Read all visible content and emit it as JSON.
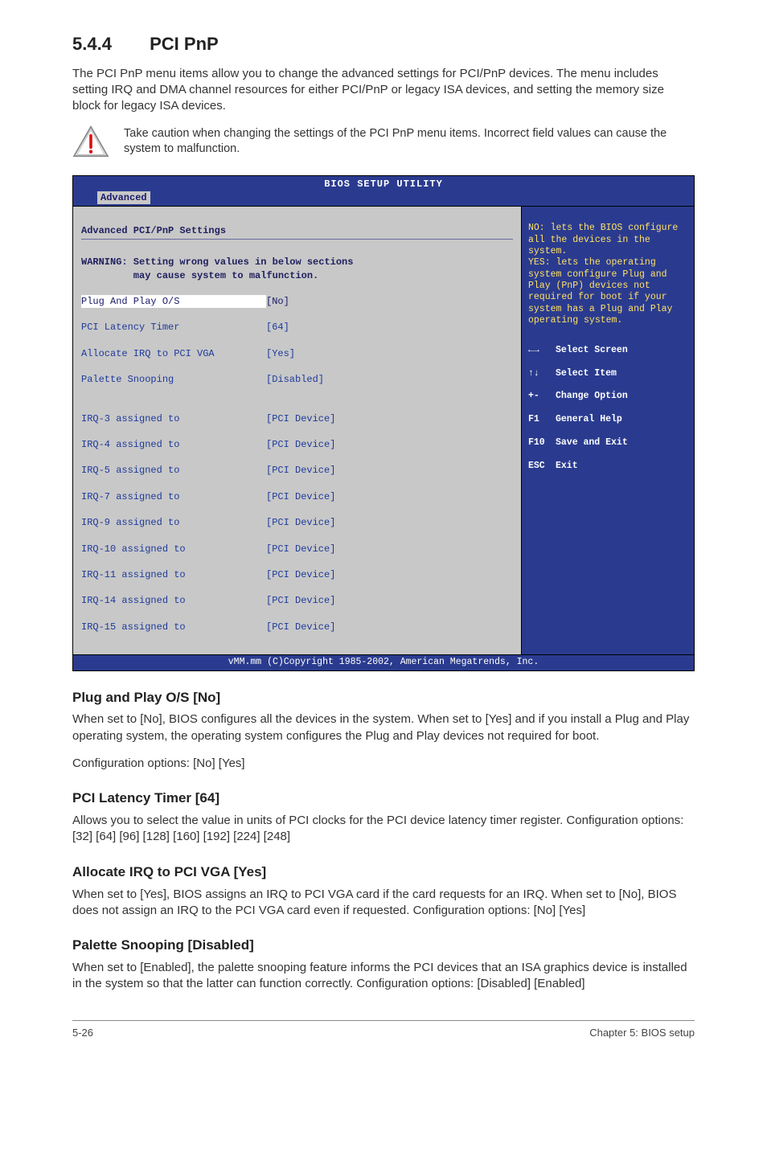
{
  "section": {
    "number": "5.4.4",
    "title": "PCI PnP",
    "intro": "The PCI PnP menu items allow you to change the advanced settings for PCI/PnP devices. The menu includes setting IRQ and DMA channel resources for either PCI/PnP or legacy ISA devices, and setting the memory size block for legacy ISA devices.",
    "caution": "Take caution when changing the settings of the PCI PnP menu items. Incorrect field values can cause the system to malfunction."
  },
  "bios": {
    "title": "BIOS SETUP UTILITY",
    "tab": "Advanced",
    "panel_title": "Advanced PCI/PnP Settings",
    "warning_l1": "WARNING: Setting wrong values in below sections",
    "warning_l2": "         may cause system to malfunction.",
    "rows": [
      {
        "label": "Plug And Play O/S",
        "value": "[No]",
        "selected": true
      },
      {
        "label": "PCI Latency Timer",
        "value": "[64]"
      },
      {
        "label": "Allocate IRQ to PCI VGA",
        "value": "[Yes]"
      },
      {
        "label": "Palette Snooping",
        "value": "[Disabled]"
      }
    ],
    "irq_rows": [
      {
        "label": "IRQ-3 assigned to",
        "value": "[PCI Device]"
      },
      {
        "label": "IRQ-4 assigned to",
        "value": "[PCI Device]"
      },
      {
        "label": "IRQ-5 assigned to",
        "value": "[PCI Device]"
      },
      {
        "label": "IRQ-7 assigned to",
        "value": "[PCI Device]"
      },
      {
        "label": "IRQ-9 assigned to",
        "value": "[PCI Device]"
      },
      {
        "label": "IRQ-10 assigned to",
        "value": "[PCI Device]"
      },
      {
        "label": "IRQ-11 assigned to",
        "value": "[PCI Device]"
      },
      {
        "label": "IRQ-14 assigned to",
        "value": "[PCI Device]"
      },
      {
        "label": "IRQ-15 assigned to",
        "value": "[PCI Device]"
      }
    ],
    "help_text": "NO: lets the BIOS configure all the devices in the system.\nYES: lets the operating system configure Plug and Play (PnP) devices not required for boot if your system has a Plug and Play operating system.",
    "legend": [
      {
        "key": "←→",
        "label": "Select Screen"
      },
      {
        "key": "↑↓",
        "label": "Select Item"
      },
      {
        "key": "+-",
        "label": "Change Option"
      },
      {
        "key": "F1",
        "label": "General Help"
      },
      {
        "key": "F10",
        "label": "Save and Exit"
      },
      {
        "key": "ESC",
        "label": "Exit"
      }
    ],
    "footer": "vMM.mm (C)Copyright 1985-2002, American Megatrends, Inc."
  },
  "subsections": {
    "plug": {
      "title": "Plug and Play O/S [No]",
      "body": "When set to [No], BIOS configures all the devices in the system. When set to [Yes] and if you install a Plug and Play operating system, the operating system configures the Plug and Play devices not required for boot.",
      "opts": "Configuration options: [No] [Yes]"
    },
    "latency": {
      "title": "PCI Latency Timer [64]",
      "body": "Allows you to select the value in units of PCI clocks for the PCI device latency timer register. Configuration options: [32] [64] [96] [128] [160] [192] [224] [248]"
    },
    "irqvga": {
      "title": "Allocate IRQ to PCI VGA [Yes]",
      "body": "When set to [Yes], BIOS assigns an IRQ to PCI VGA card if the card requests for an IRQ. When set to [No], BIOS does not assign an IRQ to the PCI VGA card even if requested. Configuration options: [No] [Yes]"
    },
    "palette": {
      "title": "Palette Snooping [Disabled]",
      "body": "When set to [Enabled], the palette snooping feature informs the PCI devices that an ISA graphics device is installed in the system so that the latter can function correctly. Configuration options: [Disabled] [Enabled]"
    }
  },
  "footer": {
    "left": "5-26",
    "right": "Chapter 5: BIOS setup"
  }
}
